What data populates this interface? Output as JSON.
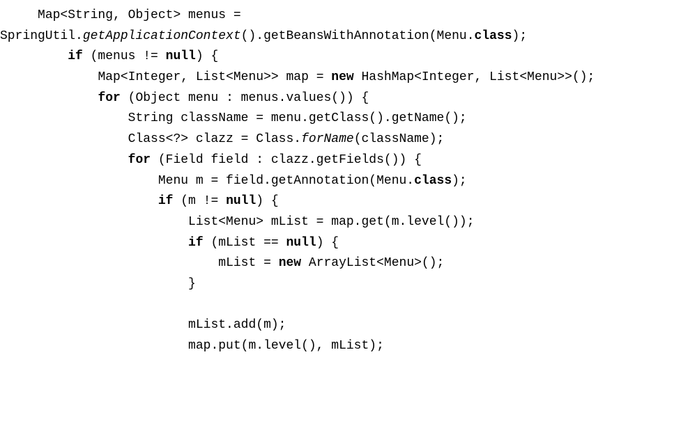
{
  "lines": [
    {
      "indent": "     ",
      "tokens": [
        {
          "text": "Map<String, Object> menus =",
          "style": ""
        }
      ]
    },
    {
      "indent": "",
      "tokens": [
        {
          "text": "SpringUtil.",
          "style": ""
        },
        {
          "text": "getApplicationContext",
          "style": "italic"
        },
        {
          "text": "().getBeansWithAnnotation(Menu.",
          "style": ""
        },
        {
          "text": "class",
          "style": "keyword"
        },
        {
          "text": ");",
          "style": ""
        }
      ]
    },
    {
      "indent": "         ",
      "tokens": [
        {
          "text": "if",
          "style": "keyword"
        },
        {
          "text": " (menus != ",
          "style": ""
        },
        {
          "text": "null",
          "style": "keyword"
        },
        {
          "text": ") {",
          "style": ""
        }
      ]
    },
    {
      "indent": "             ",
      "tokens": [
        {
          "text": "Map<Integer, List<Menu>> map = ",
          "style": ""
        },
        {
          "text": "new",
          "style": "keyword"
        },
        {
          "text": " HashMap<Integer, List<Menu>>();",
          "style": ""
        }
      ]
    },
    {
      "indent": "             ",
      "tokens": [
        {
          "text": "for",
          "style": "keyword"
        },
        {
          "text": " (Object menu : menus.values()) {",
          "style": ""
        }
      ]
    },
    {
      "indent": "                 ",
      "tokens": [
        {
          "text": "String className = menu.getClass().getName();",
          "style": ""
        }
      ]
    },
    {
      "indent": "                 ",
      "tokens": [
        {
          "text": "Class<?> clazz = Class.",
          "style": ""
        },
        {
          "text": "forName",
          "style": "italic"
        },
        {
          "text": "(className);",
          "style": ""
        }
      ]
    },
    {
      "indent": "                 ",
      "tokens": [
        {
          "text": "for",
          "style": "keyword"
        },
        {
          "text": " (Field field : clazz.getFields()) {",
          "style": ""
        }
      ]
    },
    {
      "indent": "                     ",
      "tokens": [
        {
          "text": "Menu m = field.getAnnotation(Menu.",
          "style": ""
        },
        {
          "text": "class",
          "style": "keyword"
        },
        {
          "text": ");",
          "style": ""
        }
      ]
    },
    {
      "indent": "                     ",
      "tokens": [
        {
          "text": "if",
          "style": "keyword"
        },
        {
          "text": " (m != ",
          "style": ""
        },
        {
          "text": "null",
          "style": "keyword"
        },
        {
          "text": ") {",
          "style": ""
        }
      ]
    },
    {
      "indent": "                         ",
      "tokens": [
        {
          "text": "List<Menu> mList = map.get(m.level());",
          "style": ""
        }
      ]
    },
    {
      "indent": "                         ",
      "tokens": [
        {
          "text": "if",
          "style": "keyword"
        },
        {
          "text": " (mList == ",
          "style": ""
        },
        {
          "text": "null",
          "style": "keyword"
        },
        {
          "text": ") {",
          "style": ""
        }
      ]
    },
    {
      "indent": "                             ",
      "tokens": [
        {
          "text": "mList = ",
          "style": ""
        },
        {
          "text": "new",
          "style": "keyword"
        },
        {
          "text": " ArrayList<Menu>();",
          "style": ""
        }
      ]
    },
    {
      "indent": "                         ",
      "tokens": [
        {
          "text": "}",
          "style": ""
        }
      ]
    },
    {
      "indent": "",
      "tokens": [
        {
          "text": " ",
          "style": ""
        }
      ]
    },
    {
      "indent": "                         ",
      "tokens": [
        {
          "text": "mList.add(m);",
          "style": ""
        }
      ]
    },
    {
      "indent": "                         ",
      "tokens": [
        {
          "text": "map.put(m.level(), mList);",
          "style": ""
        }
      ]
    }
  ]
}
